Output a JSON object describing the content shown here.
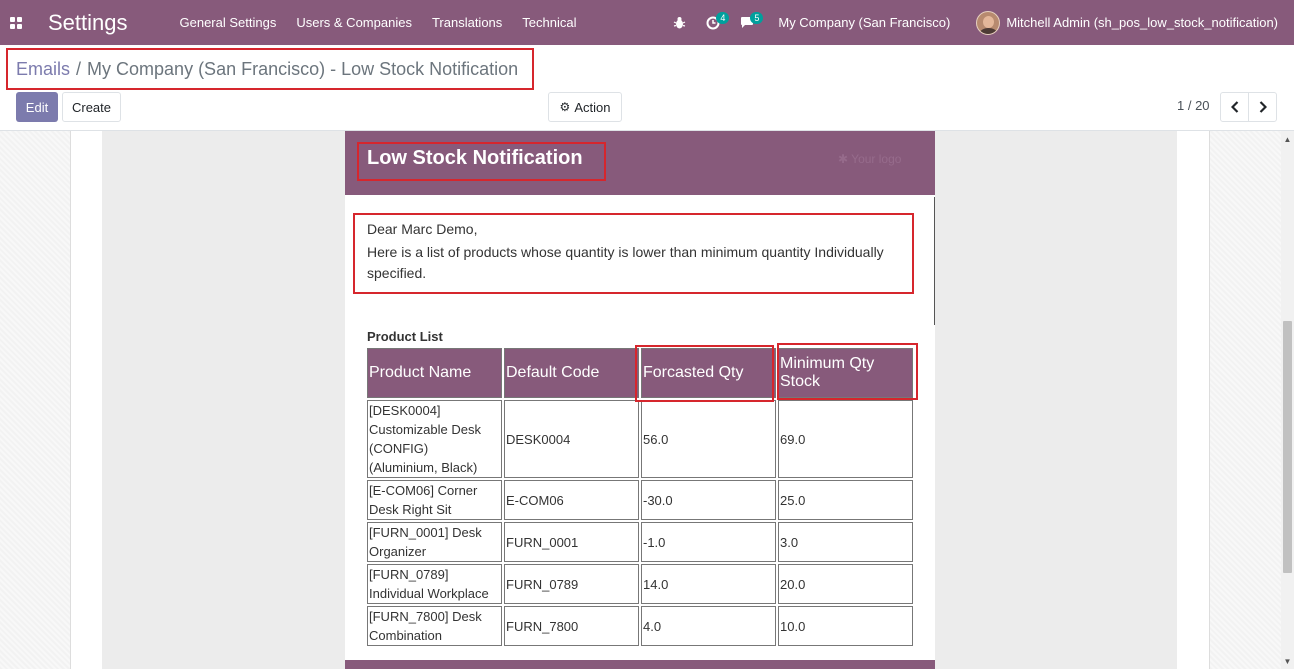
{
  "navbar": {
    "app_title": "Settings",
    "menu": [
      "General Settings",
      "Users & Companies",
      "Translations",
      "Technical"
    ],
    "activity_badge": "4",
    "messages_badge": "5",
    "company": "My Company (San Francisco)",
    "user": "Mitchell Admin (sh_pos_low_stock_notification)",
    "icons": [
      "apps-icon",
      "bug-icon",
      "clock-icon",
      "chat-icon",
      "avatar"
    ]
  },
  "breadcrumb": {
    "parent": "Emails",
    "separator": "/",
    "current": "My Company (San Francisco) - Low Stock Notification"
  },
  "toolbar": {
    "edit_label": "Edit",
    "create_label": "Create",
    "action_label": "Action"
  },
  "pager": {
    "value": "1 / 20"
  },
  "email": {
    "title": "Low Stock Notification",
    "logo_text": "✱ Your logo",
    "greeting": "Dear Marc Demo,",
    "message": "Here is a list of products whose quantity is lower than minimum quantity Individually specified.",
    "list_title": "Product List",
    "columns": [
      "Product Name",
      "Default Code",
      "Forcasted Qty",
      "Minimum Qty Stock"
    ],
    "rows": [
      [
        "[DESK0004] Customizable Desk (CONFIG) (Aluminium, Black)",
        "DESK0004",
        "56.0",
        "69.0"
      ],
      [
        "[E-COM06] Corner Desk Right Sit",
        "E-COM06",
        "-30.0",
        "25.0"
      ],
      [
        "[FURN_0001] Desk Organizer",
        "FURN_0001",
        "-1.0",
        "3.0"
      ],
      [
        "[FURN_0789] Individual Workplace",
        "FURN_0789",
        "14.0",
        "20.0"
      ],
      [
        "[FURN_7800] Desk Combination",
        "FURN_7800",
        "4.0",
        "10.0"
      ]
    ]
  },
  "colors": {
    "brand": "#875a7b",
    "accent": "#7c7bad",
    "highlight": "#d6262d"
  }
}
